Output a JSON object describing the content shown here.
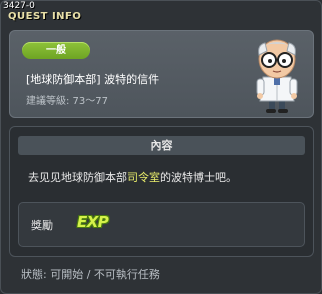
{
  "window": {
    "id_text": "3427-0",
    "title": "QUEST INFO"
  },
  "quest": {
    "category": "一般",
    "name": "[地球防御本部] 波特的信件",
    "level": "建議等級: 73～77",
    "npc_icon": "scientist-npc-icon"
  },
  "content": {
    "header": "內容",
    "text_before": "去见见地球防御本部",
    "text_highlight": "司令室",
    "text_after": "的波特博士吧。"
  },
  "reward": {
    "label": "獎勵",
    "exp_text": "EXP"
  },
  "status": {
    "text": "狀態: 可開始 / 不可執行任務"
  },
  "colors": {
    "badge_green": "#7fb32f",
    "highlight_yellow": "#e8ec6a",
    "title_gold": "#e9e0a8"
  }
}
